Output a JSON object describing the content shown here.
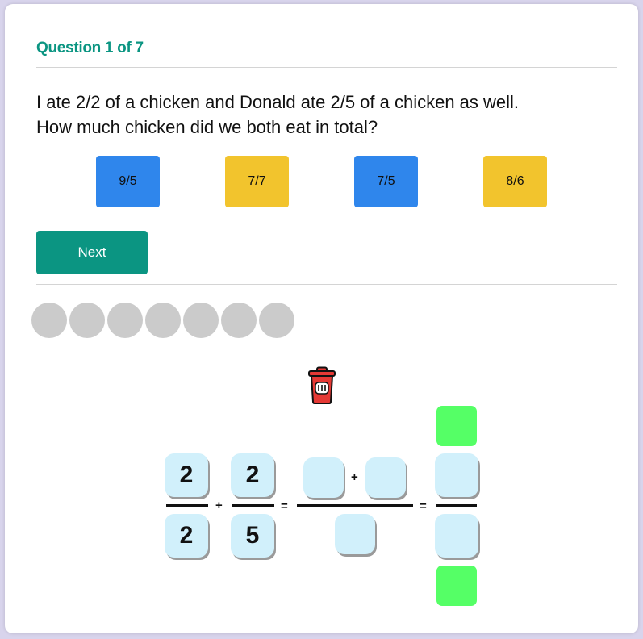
{
  "quiz": {
    "question_label": "Question 1 of 7",
    "prompt_line1": "I ate 2/2 of a chicken and Donald ate 2/5 of a chicken as well.",
    "prompt_line2": "How much chicken did we both eat in total?",
    "choices": [
      "9/5",
      "7/7",
      "7/5",
      "8/6"
    ],
    "next_label": "Next",
    "progress_total": 7,
    "progress_done": 0
  },
  "equation": {
    "fraction1": {
      "numerator": "2",
      "denominator": "2"
    },
    "fraction2": {
      "numerator": "2",
      "denominator": "5"
    },
    "plus": "+",
    "equals": "=",
    "sum_plus": "+",
    "equals2": "="
  },
  "colors": {
    "accent": "#0b9582",
    "choice_blue": "#2f86ec",
    "choice_yellow": "#f2c42d",
    "tile": "#d1f0fb",
    "stepper_green": "#55ff66",
    "trash_red": "#e53935"
  },
  "icons": {
    "trash": "trash-icon"
  }
}
